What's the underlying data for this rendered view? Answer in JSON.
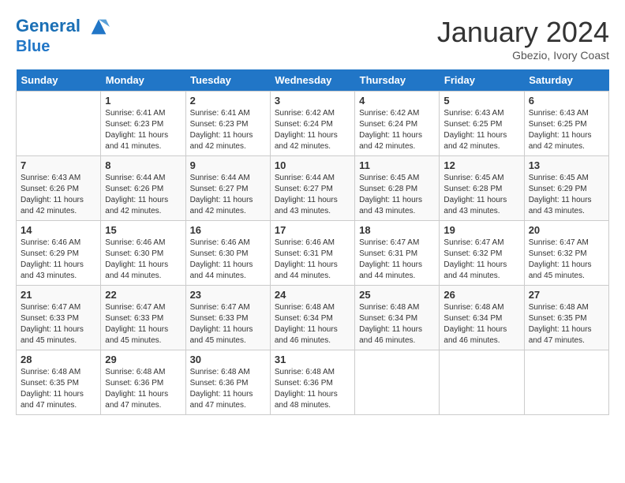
{
  "header": {
    "logo_line1": "General",
    "logo_line2": "Blue",
    "month_title": "January 2024",
    "location": "Gbezio, Ivory Coast"
  },
  "days_of_week": [
    "Sunday",
    "Monday",
    "Tuesday",
    "Wednesday",
    "Thursday",
    "Friday",
    "Saturday"
  ],
  "weeks": [
    [
      {
        "day": "",
        "sunrise": "",
        "sunset": "",
        "daylight": ""
      },
      {
        "day": "1",
        "sunrise": "Sunrise: 6:41 AM",
        "sunset": "Sunset: 6:23 PM",
        "daylight": "Daylight: 11 hours and 41 minutes."
      },
      {
        "day": "2",
        "sunrise": "Sunrise: 6:41 AM",
        "sunset": "Sunset: 6:23 PM",
        "daylight": "Daylight: 11 hours and 42 minutes."
      },
      {
        "day": "3",
        "sunrise": "Sunrise: 6:42 AM",
        "sunset": "Sunset: 6:24 PM",
        "daylight": "Daylight: 11 hours and 42 minutes."
      },
      {
        "day": "4",
        "sunrise": "Sunrise: 6:42 AM",
        "sunset": "Sunset: 6:24 PM",
        "daylight": "Daylight: 11 hours and 42 minutes."
      },
      {
        "day": "5",
        "sunrise": "Sunrise: 6:43 AM",
        "sunset": "Sunset: 6:25 PM",
        "daylight": "Daylight: 11 hours and 42 minutes."
      },
      {
        "day": "6",
        "sunrise": "Sunrise: 6:43 AM",
        "sunset": "Sunset: 6:25 PM",
        "daylight": "Daylight: 11 hours and 42 minutes."
      }
    ],
    [
      {
        "day": "7",
        "sunrise": "Sunrise: 6:43 AM",
        "sunset": "Sunset: 6:26 PM",
        "daylight": "Daylight: 11 hours and 42 minutes."
      },
      {
        "day": "8",
        "sunrise": "Sunrise: 6:44 AM",
        "sunset": "Sunset: 6:26 PM",
        "daylight": "Daylight: 11 hours and 42 minutes."
      },
      {
        "day": "9",
        "sunrise": "Sunrise: 6:44 AM",
        "sunset": "Sunset: 6:27 PM",
        "daylight": "Daylight: 11 hours and 42 minutes."
      },
      {
        "day": "10",
        "sunrise": "Sunrise: 6:44 AM",
        "sunset": "Sunset: 6:27 PM",
        "daylight": "Daylight: 11 hours and 43 minutes."
      },
      {
        "day": "11",
        "sunrise": "Sunrise: 6:45 AM",
        "sunset": "Sunset: 6:28 PM",
        "daylight": "Daylight: 11 hours and 43 minutes."
      },
      {
        "day": "12",
        "sunrise": "Sunrise: 6:45 AM",
        "sunset": "Sunset: 6:28 PM",
        "daylight": "Daylight: 11 hours and 43 minutes."
      },
      {
        "day": "13",
        "sunrise": "Sunrise: 6:45 AM",
        "sunset": "Sunset: 6:29 PM",
        "daylight": "Daylight: 11 hours and 43 minutes."
      }
    ],
    [
      {
        "day": "14",
        "sunrise": "Sunrise: 6:46 AM",
        "sunset": "Sunset: 6:29 PM",
        "daylight": "Daylight: 11 hours and 43 minutes."
      },
      {
        "day": "15",
        "sunrise": "Sunrise: 6:46 AM",
        "sunset": "Sunset: 6:30 PM",
        "daylight": "Daylight: 11 hours and 44 minutes."
      },
      {
        "day": "16",
        "sunrise": "Sunrise: 6:46 AM",
        "sunset": "Sunset: 6:30 PM",
        "daylight": "Daylight: 11 hours and 44 minutes."
      },
      {
        "day": "17",
        "sunrise": "Sunrise: 6:46 AM",
        "sunset": "Sunset: 6:31 PM",
        "daylight": "Daylight: 11 hours and 44 minutes."
      },
      {
        "day": "18",
        "sunrise": "Sunrise: 6:47 AM",
        "sunset": "Sunset: 6:31 PM",
        "daylight": "Daylight: 11 hours and 44 minutes."
      },
      {
        "day": "19",
        "sunrise": "Sunrise: 6:47 AM",
        "sunset": "Sunset: 6:32 PM",
        "daylight": "Daylight: 11 hours and 44 minutes."
      },
      {
        "day": "20",
        "sunrise": "Sunrise: 6:47 AM",
        "sunset": "Sunset: 6:32 PM",
        "daylight": "Daylight: 11 hours and 45 minutes."
      }
    ],
    [
      {
        "day": "21",
        "sunrise": "Sunrise: 6:47 AM",
        "sunset": "Sunset: 6:33 PM",
        "daylight": "Daylight: 11 hours and 45 minutes."
      },
      {
        "day": "22",
        "sunrise": "Sunrise: 6:47 AM",
        "sunset": "Sunset: 6:33 PM",
        "daylight": "Daylight: 11 hours and 45 minutes."
      },
      {
        "day": "23",
        "sunrise": "Sunrise: 6:47 AM",
        "sunset": "Sunset: 6:33 PM",
        "daylight": "Daylight: 11 hours and 45 minutes."
      },
      {
        "day": "24",
        "sunrise": "Sunrise: 6:48 AM",
        "sunset": "Sunset: 6:34 PM",
        "daylight": "Daylight: 11 hours and 46 minutes."
      },
      {
        "day": "25",
        "sunrise": "Sunrise: 6:48 AM",
        "sunset": "Sunset: 6:34 PM",
        "daylight": "Daylight: 11 hours and 46 minutes."
      },
      {
        "day": "26",
        "sunrise": "Sunrise: 6:48 AM",
        "sunset": "Sunset: 6:34 PM",
        "daylight": "Daylight: 11 hours and 46 minutes."
      },
      {
        "day": "27",
        "sunrise": "Sunrise: 6:48 AM",
        "sunset": "Sunset: 6:35 PM",
        "daylight": "Daylight: 11 hours and 47 minutes."
      }
    ],
    [
      {
        "day": "28",
        "sunrise": "Sunrise: 6:48 AM",
        "sunset": "Sunset: 6:35 PM",
        "daylight": "Daylight: 11 hours and 47 minutes."
      },
      {
        "day": "29",
        "sunrise": "Sunrise: 6:48 AM",
        "sunset": "Sunset: 6:36 PM",
        "daylight": "Daylight: 11 hours and 47 minutes."
      },
      {
        "day": "30",
        "sunrise": "Sunrise: 6:48 AM",
        "sunset": "Sunset: 6:36 PM",
        "daylight": "Daylight: 11 hours and 47 minutes."
      },
      {
        "day": "31",
        "sunrise": "Sunrise: 6:48 AM",
        "sunset": "Sunset: 6:36 PM",
        "daylight": "Daylight: 11 hours and 48 minutes."
      },
      {
        "day": "",
        "sunrise": "",
        "sunset": "",
        "daylight": ""
      },
      {
        "day": "",
        "sunrise": "",
        "sunset": "",
        "daylight": ""
      },
      {
        "day": "",
        "sunrise": "",
        "sunset": "",
        "daylight": ""
      }
    ]
  ]
}
